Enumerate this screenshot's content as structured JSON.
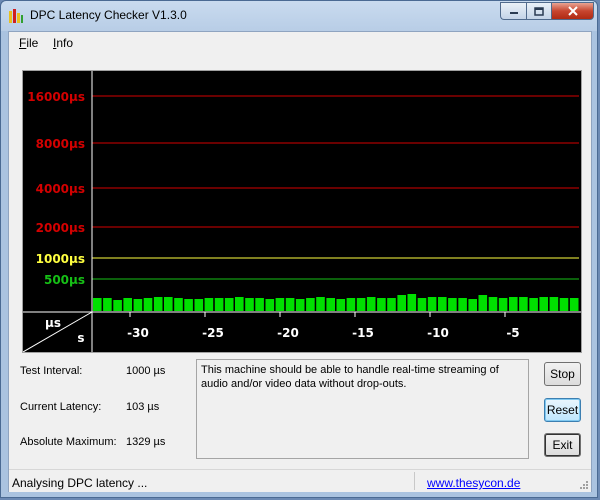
{
  "window": {
    "title": "DPC Latency Checker V1.3.0"
  },
  "menu": {
    "file_prefix": "F",
    "file_rest": "ile",
    "info_prefix": "I",
    "info_rest": "nfo"
  },
  "colors": {
    "red_line": "#d40000",
    "yellow_line": "#ffff40",
    "green_line": "#16c016",
    "bar": "#00e000"
  },
  "chart_data": {
    "type": "bar",
    "y_levels": [
      {
        "label": "16000µs",
        "color": "red"
      },
      {
        "label": "8000µs",
        "color": "red"
      },
      {
        "label": "4000µs",
        "color": "red"
      },
      {
        "label": "2000µs",
        "color": "red"
      },
      {
        "label": "1000µs",
        "color": "yellow"
      },
      {
        "label": "500µs",
        "color": "green"
      }
    ],
    "ylabel": "µs",
    "xlabel": "s",
    "x_ticks": [
      "-30",
      "-25",
      "-20",
      "-15",
      "-10",
      "-5"
    ],
    "values": [
      110,
      110,
      105,
      110,
      108,
      110,
      112,
      112,
      110,
      108,
      108,
      110,
      110,
      110,
      112,
      110,
      110,
      108,
      110,
      110,
      108,
      110,
      112,
      110,
      108,
      110,
      110,
      112,
      110,
      110,
      115,
      118,
      110,
      112,
      112,
      110,
      110,
      108,
      115,
      112,
      110,
      112,
      112,
      110,
      112,
      112,
      110,
      110
    ],
    "unit": "µs"
  },
  "stats": {
    "test_interval_label": "Test Interval:",
    "test_interval_value": "1000 µs",
    "current_latency_label": "Current Latency:",
    "current_latency_value": "103 µs",
    "absolute_max_label": "Absolute Maximum:",
    "absolute_max_value": "1329 µs"
  },
  "message": "This machine should be able to handle real-time streaming of audio and/or video data without drop-outs.",
  "buttons": {
    "stop": "Stop",
    "reset": "Reset",
    "exit": "Exit"
  },
  "status": {
    "text": "Analysing DPC latency ...",
    "link": "www.thesycon.de"
  }
}
